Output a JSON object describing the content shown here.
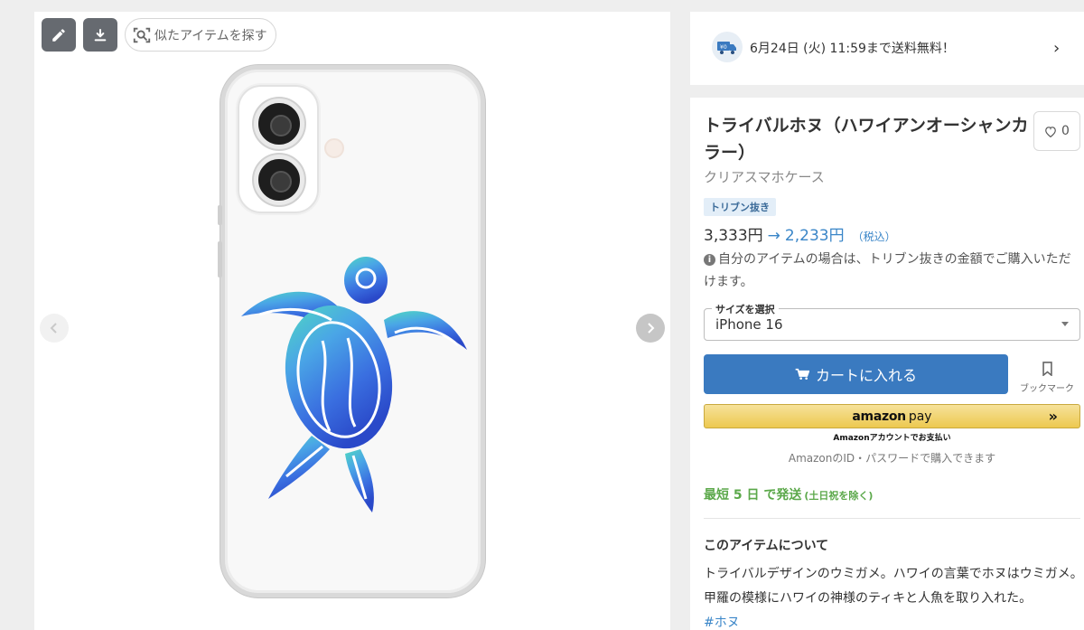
{
  "image_toolbar": {
    "edit_icon": "pencil-icon",
    "download_icon": "download-icon",
    "similar_label": "似たアイテムを探す",
    "similar_icon": "visual-search-icon"
  },
  "shipping_banner": {
    "icon": "free-shipping-truck-icon",
    "icon_text": "¥0",
    "text": "6月24日 (火) 11:59まで送料無料！"
  },
  "product": {
    "title": "トライバルホヌ（ハワイアンオーシャンカラー）",
    "subtitle": "クリアスマホケース",
    "favorite_count": "0",
    "badge": "トリブン抜き",
    "price_original": "3,333円",
    "price_arrow": "→",
    "price_sale": "2,233円",
    "price_tax": "（税込）",
    "note": "自分のアイテムの場合は、トリブン抜きの金額でご購入いただけます。",
    "size_label": "サイズを選択",
    "size_value": "iPhone 16",
    "cart_label": "カートに入れる",
    "bookmark_label": "ブックマーク",
    "amazon_logo": "amazon",
    "amazon_pay": "pay",
    "amazon_arrows": "»",
    "amazon_sub": "Amazonアカウントでお支払い",
    "amazon_note": "AmazonのID・パスワードで購入できます",
    "ship_days": "最短 5 日 で発送",
    "ship_days_note": "(土日祝を除く)",
    "about_heading": "このアイテムについて",
    "about_text": "トライバルデザインのウミガメ。ハワイの言葉でホヌはウミガメ。甲羅の模様にハワイの神様のティキと人魚を取り入れた。",
    "tag": "#ホヌ"
  },
  "colors": {
    "accent": "#3a7ac0",
    "price_blue": "#3a86c8",
    "ship_green": "#5ba84a",
    "amazon_gold": "#edc94f"
  }
}
